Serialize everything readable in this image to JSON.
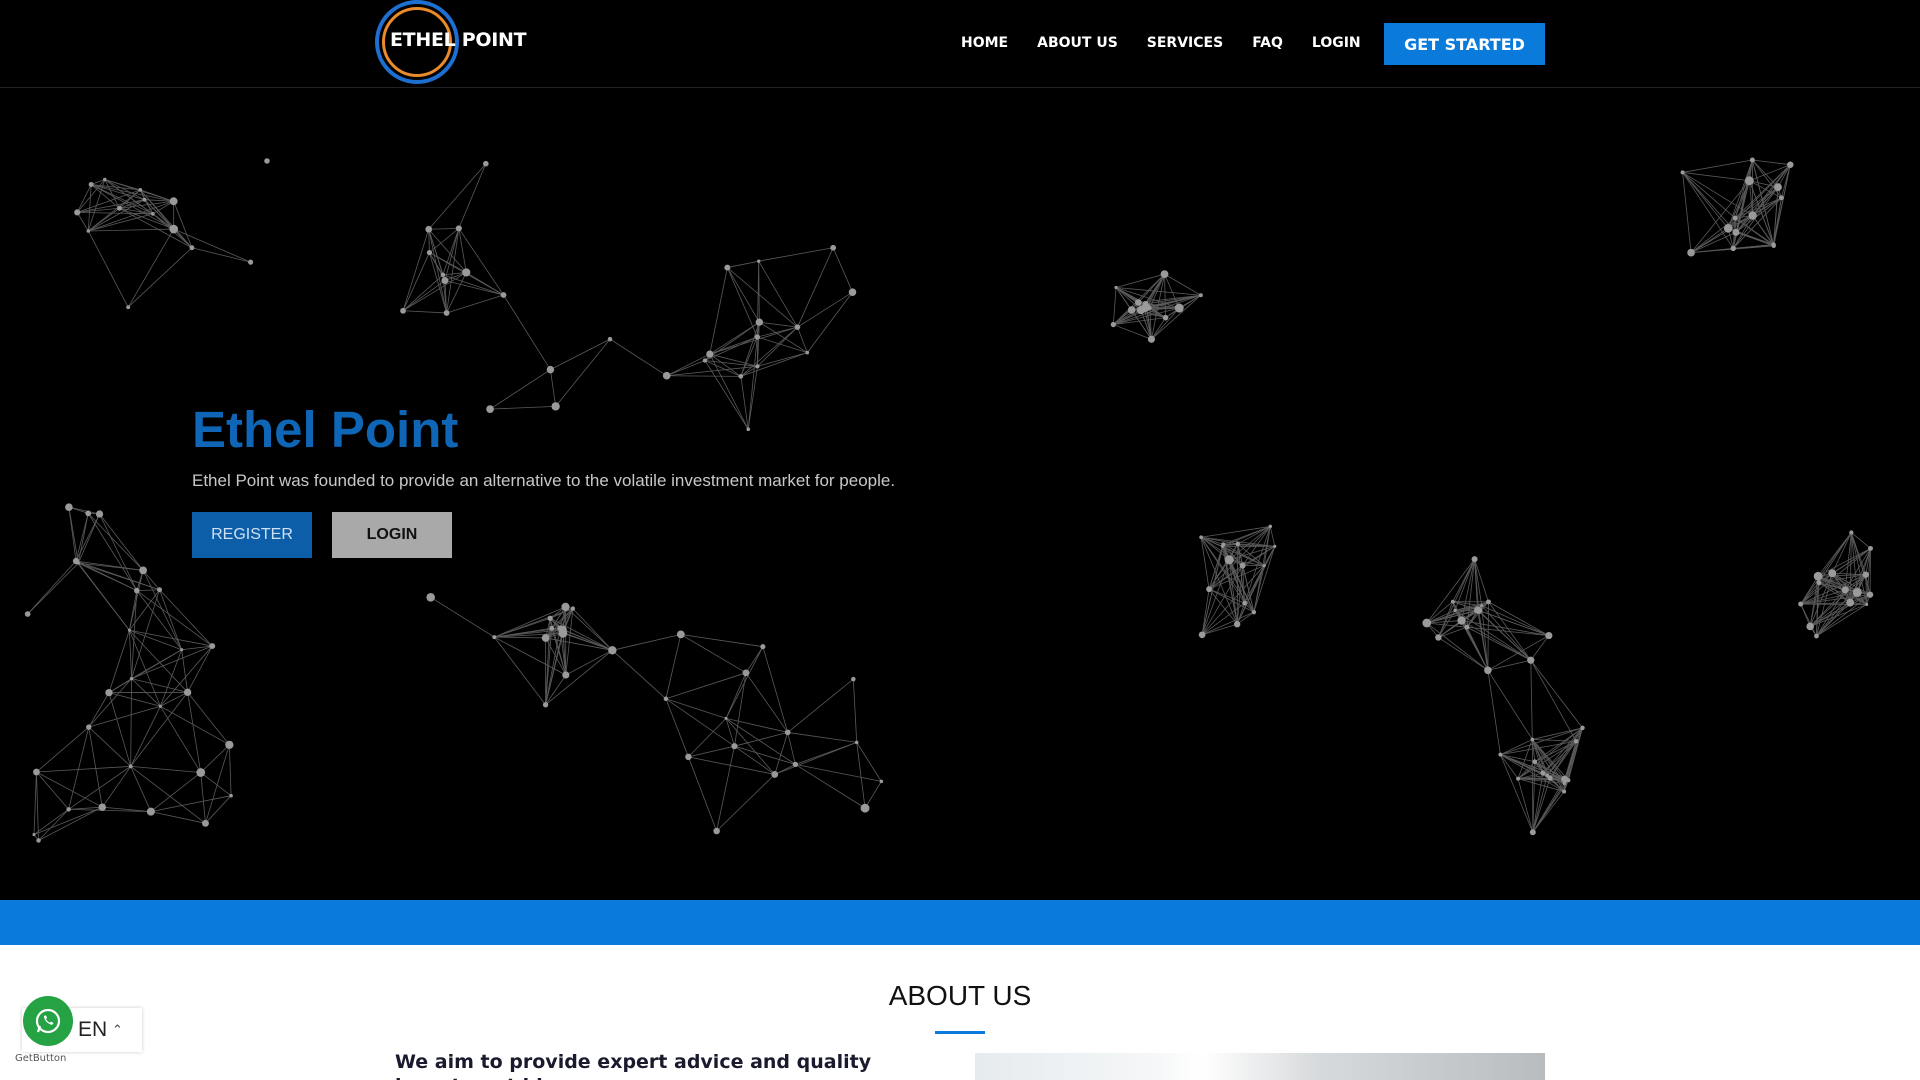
{
  "header": {
    "logo_text": "ETHEL POINT",
    "nav": [
      "HOME",
      "ABOUT US",
      "SERVICES",
      "FAQ",
      "LOGIN"
    ],
    "cta_label": "GET STARTED"
  },
  "hero": {
    "title": "Ethel Point",
    "subtitle": "Ethel Point was founded to provide an alternative to the volatile investment market for people.",
    "register_label": "REGISTER",
    "login_label": "LOGIN"
  },
  "about": {
    "title": "ABOUT US",
    "text": "We aim to provide expert advice and quality investment ideas"
  },
  "widgets": {
    "language": "EN",
    "getbutton": "GetButton"
  },
  "colors": {
    "accent": "#0a7bdc",
    "hero_title": "#0f66b7",
    "whatsapp": "#25a244"
  }
}
